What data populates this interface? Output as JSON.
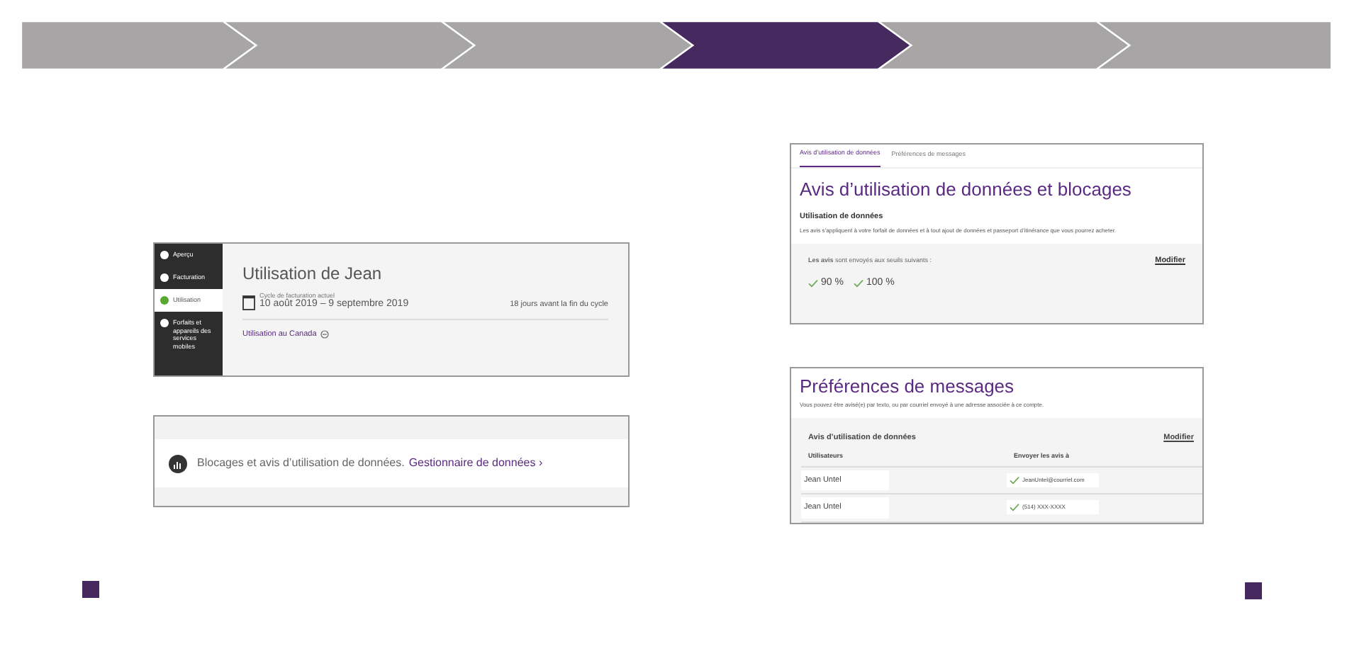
{
  "steps": [
    {
      "selected": false
    },
    {
      "selected": false
    },
    {
      "selected": false
    },
    {
      "selected": true
    },
    {
      "selected": false
    },
    {
      "selected": false
    }
  ],
  "usage_panel": {
    "sidebar": [
      {
        "label": "Aperçu",
        "selected": false
      },
      {
        "label": "Facturation",
        "selected": false
      },
      {
        "label": "Utilisation",
        "selected": true
      },
      {
        "label": "Forfaits et appareils des services mobiles",
        "selected": false
      }
    ],
    "title": "Utilisation de Jean",
    "cycle_label": "Cycle de facturation actuel",
    "cycle_dates": "10 août 2019 – 9 septembre 2019",
    "days_left": "18 jours avant la fin du cycle",
    "link": "Utilisation au Canada"
  },
  "data_manager_banner": {
    "text": "Blocages et avis d’utilisation de données.",
    "link": "Gestionnaire de données ›"
  },
  "notifications_panel": {
    "tabs": [
      {
        "label": "Avis d’utilisation de données",
        "selected": true
      },
      {
        "label": "Préférences de messages",
        "selected": false
      }
    ],
    "title": "Avis d’utilisation de données et blocages",
    "section_title": "Utilisation de données",
    "description": "Les avis s’appliquent à votre forfait de données et à tout ajout de données et passeport d’itinérance que vous pourrez acheter.",
    "alert_label": "**Les avis** sont envoyés aux seuils suivants :",
    "modify": "Modifier",
    "thresholds": [
      {
        "label": "90 %",
        "checked": true
      },
      {
        "label": "100 %",
        "checked": true
      }
    ]
  },
  "preferences_panel": {
    "title": "Préférences de messages",
    "description": "Vous pouvez être avisé(e) par texto, ou par courriel envoyé à une adresse associée à ce compte.",
    "box_title": "Avis d’utilisation de données",
    "modify": "Modifier",
    "columns": [
      "Utilisateurs",
      "Envoyer les avis à"
    ],
    "rows": [
      {
        "user": "Jean Untel",
        "contact": "JeanUntel@courriel.com",
        "checked": true
      },
      {
        "user": "Jean Untel",
        "contact": "(514) XXX-XXXX",
        "checked": true
      }
    ]
  }
}
